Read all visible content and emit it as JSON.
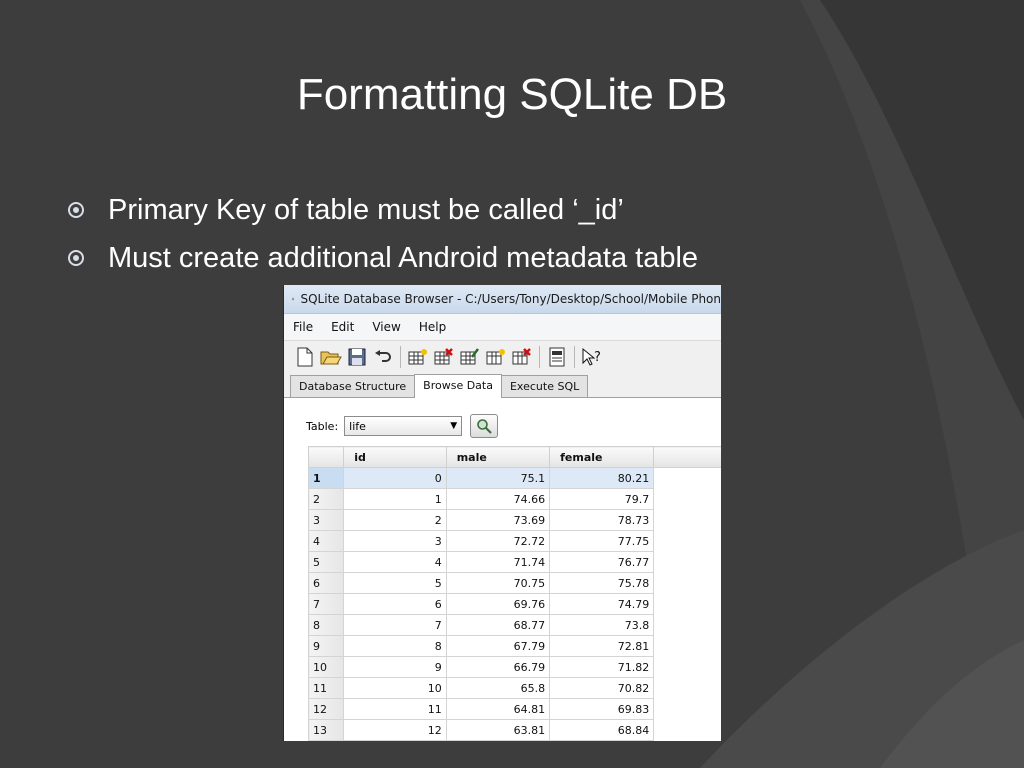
{
  "slide": {
    "title": "Formatting SQLite DB",
    "bullets": [
      "Primary Key of table must be called ‘_id’",
      "Must create additional Android metadata table"
    ]
  },
  "app": {
    "window_title": "SQLite Database Browser - C:/Users/Tony/Desktop/School/Mobile Phon",
    "menu": [
      "File",
      "Edit",
      "View",
      "Help"
    ],
    "toolbar_icons": [
      "new-db-icon",
      "open-db-icon",
      "save-db-icon",
      "undo-icon",
      "create-table-icon",
      "delete-table-icon",
      "modify-table-icon",
      "create-index-icon",
      "delete-index-icon",
      "log-icon",
      "whats-this-icon"
    ],
    "tabs": [
      "Database Structure",
      "Browse Data",
      "Execute SQL"
    ],
    "active_tab": "Browse Data",
    "table_label": "Table:",
    "table_selected": "life",
    "columns": [
      "id",
      "male",
      "female"
    ],
    "rows": [
      {
        "n": "1",
        "id": "0",
        "male": "75.1",
        "female": "80.21"
      },
      {
        "n": "2",
        "id": "1",
        "male": "74.66",
        "female": "79.7"
      },
      {
        "n": "3",
        "id": "2",
        "male": "73.69",
        "female": "78.73"
      },
      {
        "n": "4",
        "id": "3",
        "male": "72.72",
        "female": "77.75"
      },
      {
        "n": "5",
        "id": "4",
        "male": "71.74",
        "female": "76.77"
      },
      {
        "n": "6",
        "id": "5",
        "male": "70.75",
        "female": "75.78"
      },
      {
        "n": "7",
        "id": "6",
        "male": "69.76",
        "female": "74.79"
      },
      {
        "n": "8",
        "id": "7",
        "male": "68.77",
        "female": "73.8"
      },
      {
        "n": "9",
        "id": "8",
        "male": "67.79",
        "female": "72.81"
      },
      {
        "n": "10",
        "id": "9",
        "male": "66.79",
        "female": "71.82"
      },
      {
        "n": "11",
        "id": "10",
        "male": "65.8",
        "female": "70.82"
      },
      {
        "n": "12",
        "id": "11",
        "male": "64.81",
        "female": "69.83"
      },
      {
        "n": "13",
        "id": "12",
        "male": "63.81",
        "female": "68.84"
      }
    ]
  }
}
